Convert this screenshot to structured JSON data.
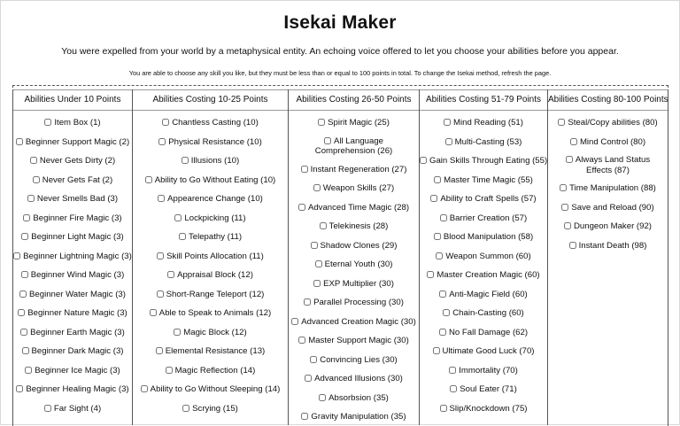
{
  "title": "Isekai Maker",
  "intro": "You were expelled from your world by a metaphysical entity. An echoing voice offered to let you choose your abilities before you appear.",
  "note": "You are able to choose any skill you like, but they must be less than or equal to 100 points in total. To change the Isekai method, refresh the page.",
  "columns": [
    {
      "header": "Abilities Under 10 Points",
      "items": [
        "Item Box (1)",
        "Beginner Support Magic (2)",
        "Never Gets Dirty (2)",
        "Never Gets Fat (2)",
        "Never Smells Bad (3)",
        "Beginner Fire Magic (3)",
        "Beginner Light Magic (3)",
        "Beginner Lightning Magic (3)",
        "Beginner Wind Magic (3)",
        "Beginner Water Magic (3)",
        "Beginner Nature Magic (3)",
        "Beginner Earth Magic (3)",
        "Beginner Dark Magic (3)",
        "Beginner Ice Magic (3)",
        "Beginner Healing Magic (3)",
        "Far Sight (4)"
      ]
    },
    {
      "header": "Abilities Costing 10-25 Points",
      "items": [
        "Chantless Casting (10)",
        "Physical Resistance (10)",
        "Illusions (10)",
        "Ability to Go Without Eating (10)",
        "Appearence Change (10)",
        "Lockpicking (11)",
        "Telepathy (11)",
        "Skill Points Allocation (11)",
        "Appraisal Block (12)",
        "Short-Range Teleport (12)",
        "Able to Speak to Animals (12)",
        "Magic Block (12)",
        "Elemental Resistance (13)",
        "Magic Reflection (14)",
        "Ability to Go Without Sleeping (14)",
        "Scrying (15)"
      ]
    },
    {
      "header": "Abilities Costing 26-50 Points",
      "items": [
        "Spirit Magic (25)",
        "All Language Comprehension (26)",
        "Instant Regeneration (27)",
        "Weapon Skills (27)",
        "Advanced Time Magic (28)",
        "Telekinesis (28)",
        "Shadow Clones (29)",
        "Eternal Youth (30)",
        "EXP Multiplier (30)",
        "Parallel Processing (30)",
        "Advanced Creation Magic (30)",
        "Master Support Magic (30)",
        "Convincing Lies (30)",
        "Advanced Illusions (30)",
        "Absorbsion (35)",
        "Gravity Manipulation (35)"
      ]
    },
    {
      "header": "Abilities Costing 51-79 Points",
      "items": [
        "Mind Reading (51)",
        "Multi-Casting (53)",
        "Gain Skills Through Eating (55)",
        "Master Time Magic (55)",
        "Ability to Craft Spells (57)",
        "Barrier Creation (57)",
        "Blood Manipulation (58)",
        "Weapon Summon (60)",
        "Master Creation Magic (60)",
        "Anti-Magic Field (60)",
        "Chain-Casting (60)",
        "No Fall Damage (62)",
        "Ultimate Good Luck (70)",
        "Immortality (70)",
        "Soul Eater (71)",
        "Slip/Knockdown (75)"
      ]
    },
    {
      "header": "Abilities Costing 80-100 Points",
      "items": [
        "Steal/Copy abilities (80)",
        "Mind Control (80)",
        "Always Land Status Effects (87)",
        "Time Manipulation (88)",
        "Save and Reload (90)",
        "Dungeon Maker (92)",
        "Instant Death (98)"
      ]
    }
  ]
}
